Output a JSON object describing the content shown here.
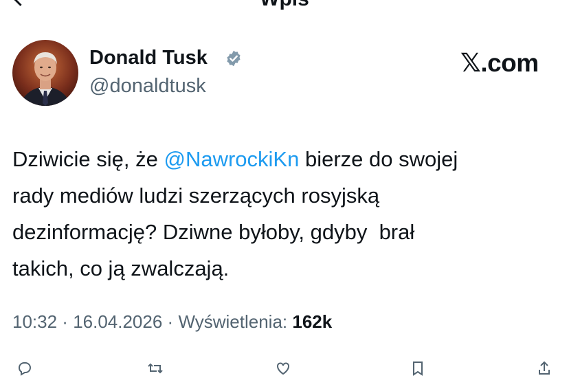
{
  "header": {
    "title": "Wpis"
  },
  "author": {
    "name": "Donald Tusk",
    "handle": "@donaldtusk",
    "verified": true
  },
  "watermark": {
    "x_glyph": "𝕏",
    "suffix": ".com"
  },
  "tweet": {
    "line1_a": "Dziwicie się, że ",
    "mention": "@NawrockiKn",
    "line1_b": " bierze do swojej",
    "line2": "rady mediów ludzi szerzących rosyjską",
    "line3": "dezinformację? Dziwne byłoby, gdyby  brał",
    "line4": "takich, co ją zwalczają."
  },
  "meta": {
    "time": "10:32",
    "sep1": " · ",
    "date": "16.04.2026",
    "sep2": " · ",
    "views_label": "Wyświetlenia: ",
    "views_count": "162k"
  },
  "colors": {
    "link": "#1d9bf0",
    "secondary": "#536471",
    "primary": "#0f1419",
    "verified_badge": "#829aab"
  },
  "icons": [
    "back-arrow-icon",
    "verified-badge-icon",
    "reply-icon",
    "retweet-icon",
    "like-icon",
    "bookmark-icon",
    "share-icon"
  ]
}
